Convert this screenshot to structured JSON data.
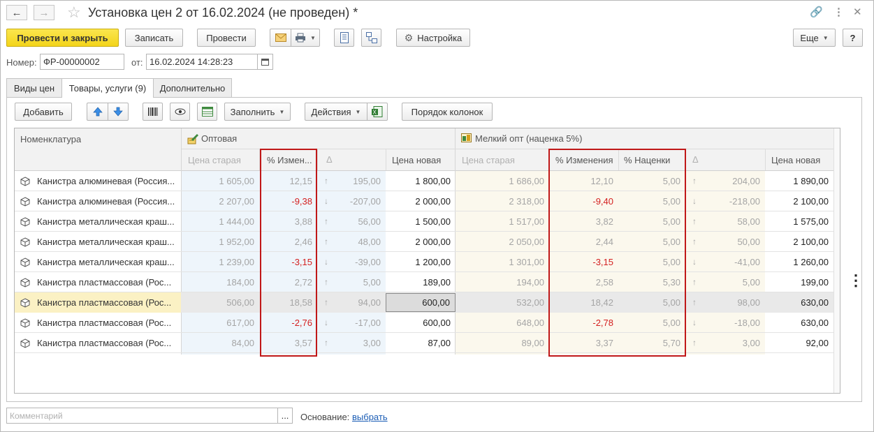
{
  "window": {
    "title": "Установка цен 2 от 16.02.2024 (не проведен) *"
  },
  "toolbar": {
    "post_close": "Провести и закрыть",
    "save": "Записать",
    "post": "Провести",
    "settings": "Настройка",
    "more": "Еще",
    "help": "?"
  },
  "doc": {
    "number_label": "Номер:",
    "number_value": "ФР-00000002",
    "date_label": "от:",
    "date_value": "16.02.2024 14:28:23"
  },
  "tabs": [
    {
      "label": "Виды цен"
    },
    {
      "label": "Товары, услуги (9)"
    },
    {
      "label": "Дополнительно"
    }
  ],
  "table_toolbar": {
    "add": "Добавить",
    "fill": "Заполнить",
    "actions": "Действия",
    "column_order": "Порядок колонок"
  },
  "table": {
    "col_item": "Номенклатура",
    "group1": "Оптовая",
    "group2": "Мелкий опт (наценка 5%)",
    "headers": {
      "old_price": "Цена старая",
      "pct_change_short": "% Измен...",
      "delta": "Δ",
      "new_price": "Цена новая",
      "pct_change": "% Изменения",
      "pct_markup": "% Наценки"
    },
    "rows": [
      {
        "name": "Канистра алюминевая (Россия...",
        "w_old": "1 605,00",
        "w_pct": "12,15",
        "w_dir": "up",
        "w_delta": "195,00",
        "w_new": "1 800,00",
        "r_old": "1 686,00",
        "r_pct": "12,10",
        "r_mk": "5,00",
        "r_dir": "up",
        "r_delta": "204,00",
        "r_new": "1 890,00"
      },
      {
        "name": "Канистра алюминевая (Россия...",
        "w_old": "2 207,00",
        "w_pct": "-9,38",
        "w_dir": "down",
        "w_delta": "-207,00",
        "w_new": "2 000,00",
        "r_old": "2 318,00",
        "r_pct": "-9,40",
        "r_mk": "5,00",
        "r_dir": "down",
        "r_delta": "-218,00",
        "r_new": "2 100,00"
      },
      {
        "name": "Канистра металлическая краш...",
        "w_old": "1 444,00",
        "w_pct": "3,88",
        "w_dir": "up",
        "w_delta": "56,00",
        "w_new": "1 500,00",
        "r_old": "1 517,00",
        "r_pct": "3,82",
        "r_mk": "5,00",
        "r_dir": "up",
        "r_delta": "58,00",
        "r_new": "1 575,00"
      },
      {
        "name": "Канистра металлическая краш...",
        "w_old": "1 952,00",
        "w_pct": "2,46",
        "w_dir": "up",
        "w_delta": "48,00",
        "w_new": "2 000,00",
        "r_old": "2 050,00",
        "r_pct": "2,44",
        "r_mk": "5,00",
        "r_dir": "up",
        "r_delta": "50,00",
        "r_new": "2 100,00"
      },
      {
        "name": "Канистра металлическая краш...",
        "w_old": "1 239,00",
        "w_pct": "-3,15",
        "w_dir": "down",
        "w_delta": "-39,00",
        "w_new": "1 200,00",
        "r_old": "1 301,00",
        "r_pct": "-3,15",
        "r_mk": "5,00",
        "r_dir": "down",
        "r_delta": "-41,00",
        "r_new": "1 260,00"
      },
      {
        "name": "Канистра пластмассовая (Рос...",
        "w_old": "184,00",
        "w_pct": "2,72",
        "w_dir": "up",
        "w_delta": "5,00",
        "w_new": "189,00",
        "r_old": "194,00",
        "r_pct": "2,58",
        "r_mk": "5,30",
        "r_dir": "up",
        "r_delta": "5,00",
        "r_new": "199,00"
      },
      {
        "name": "Канистра пластмассовая (Рос...",
        "w_old": "506,00",
        "w_pct": "18,58",
        "w_dir": "up",
        "w_delta": "94,00",
        "w_new": "600,00",
        "r_old": "532,00",
        "r_pct": "18,42",
        "r_mk": "5,00",
        "r_dir": "up",
        "r_delta": "98,00",
        "r_new": "630,00",
        "selected": true
      },
      {
        "name": "Канистра пластмассовая (Рос...",
        "w_old": "617,00",
        "w_pct": "-2,76",
        "w_dir": "down",
        "w_delta": "-17,00",
        "w_new": "600,00",
        "r_old": "648,00",
        "r_pct": "-2,78",
        "r_mk": "5,00",
        "r_dir": "down",
        "r_delta": "-18,00",
        "r_new": "630,00"
      },
      {
        "name": "Канистра пластмассовая (Рос...",
        "w_old": "84,00",
        "w_pct": "3,57",
        "w_dir": "up",
        "w_delta": "3,00",
        "w_new": "87,00",
        "r_old": "89,00",
        "r_pct": "3,37",
        "r_mk": "5,70",
        "r_dir": "up",
        "r_delta": "3,00",
        "r_new": "92,00"
      }
    ]
  },
  "footer": {
    "comment_placeholder": "Комментарий",
    "comment_btn": "...",
    "basis_label": "Основание:",
    "basis_link": "выбрать"
  },
  "colors": {
    "accent": "#f3d41a",
    "wholesale_bg": "#eef5fb",
    "retail_bg": "#fbf8ed",
    "negative": "#d42020",
    "highlight": "#c01818",
    "link": "#1b5db5"
  },
  "icons": [
    "back-arrow-icon",
    "forward-arrow-icon",
    "star-icon",
    "link-icon",
    "more-vertical-icon",
    "close-icon",
    "mail-icon",
    "print-icon",
    "document-icon",
    "structure-icon",
    "gear-icon",
    "arrow-up-icon",
    "arrow-down-icon",
    "barcode-icon",
    "eye-icon",
    "table-icon",
    "excel-icon",
    "calendar-icon",
    "product-icon"
  ]
}
